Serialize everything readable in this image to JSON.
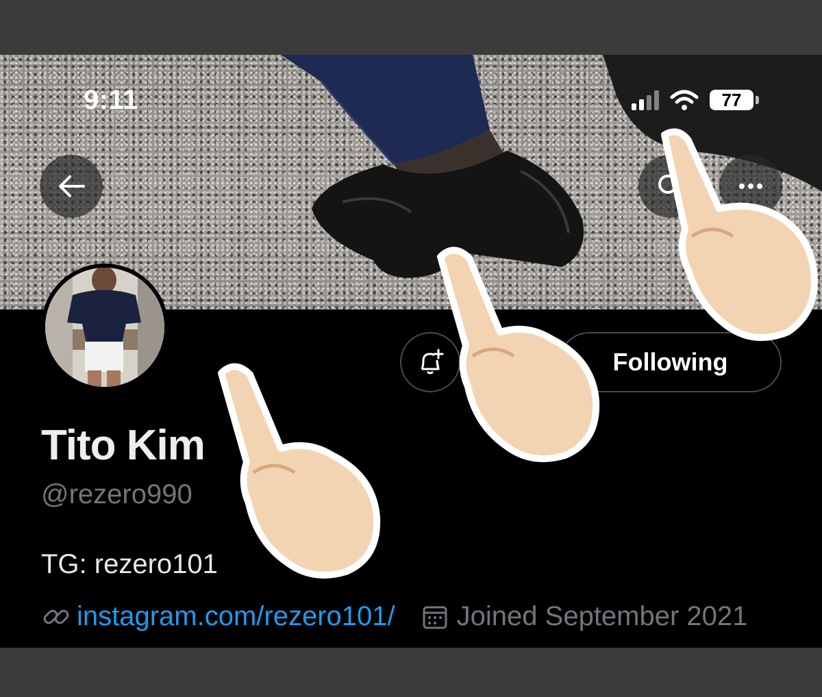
{
  "status_bar": {
    "time": "9:11",
    "battery": "77"
  },
  "profile": {
    "name": "Tito Kim",
    "handle": "@rezero990",
    "bio": "TG: rezero101",
    "link": "instagram.com/rezero101/",
    "joined": "Joined September 2021"
  },
  "actions": {
    "follow_label": "Following"
  },
  "icons": [
    "back-arrow-icon",
    "search-icon",
    "more-icon",
    "notification-bell-plus-icon",
    "link-icon",
    "calendar-icon",
    "wifi-icon",
    "signal-icon"
  ],
  "colors": {
    "link": "#1d9bf0",
    "muted": "#71767b",
    "background": "#000000"
  }
}
